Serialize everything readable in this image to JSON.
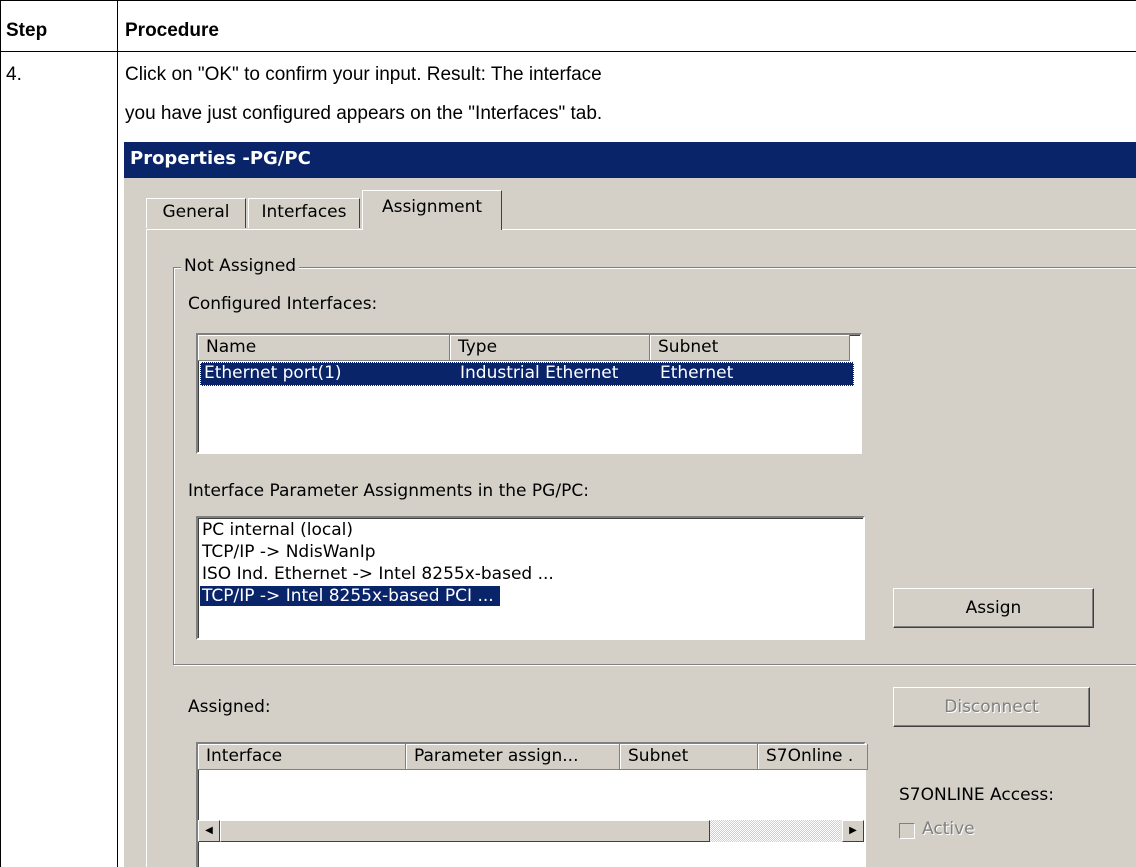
{
  "table": {
    "header_step": "Step",
    "header_procedure": "Procedure",
    "step_number": "4.",
    "instruction_line1": "Click on \"OK\" to confirm your input. Result: The interface",
    "instruction_line2": "you have just configured appears on the \"Interfaces\" tab."
  },
  "dialog": {
    "title": "Properties -PG/PC",
    "tabs": [
      {
        "label": "General",
        "active": false
      },
      {
        "label": "Interfaces",
        "active": false
      },
      {
        "label": "Assignment",
        "active": true
      }
    ],
    "not_assigned_group": "Not Assigned",
    "configured_interfaces_label": "Configured Interfaces:",
    "configured_columns": [
      "Name",
      "Type",
      "Subnet"
    ],
    "configured_rows": [
      {
        "name": "Ethernet port(1)",
        "type": "Industrial Ethernet",
        "subnet": "Ethernet",
        "selected": true
      }
    ],
    "param_assign_label": "Interface Parameter Assignments in the PG/PC:",
    "param_assign_items": [
      {
        "label": "PC internal (local)",
        "selected": false
      },
      {
        "label": "TCP/IP -> NdisWanIp",
        "selected": false
      },
      {
        "label": "ISO Ind. Ethernet -> Intel 8255x-based ...",
        "selected": false
      },
      {
        "label": "TCP/IP -> Intel 8255x-based PCI ...",
        "selected": true
      }
    ],
    "assign_button": "Assign",
    "assigned_label": "Assigned:",
    "disconnect_button": "Disconnect",
    "assigned_columns": [
      "Interface",
      "Parameter assign...",
      "Subnet",
      "S7Online ."
    ],
    "s7online_access_label": "S7ONLINE Access:",
    "active_checkbox_label": "Active",
    "active_checked": false
  },
  "colors": {
    "titlebar": "#0a246a",
    "selection": "#0a246a",
    "dialog_face": "#d4d0c8"
  }
}
